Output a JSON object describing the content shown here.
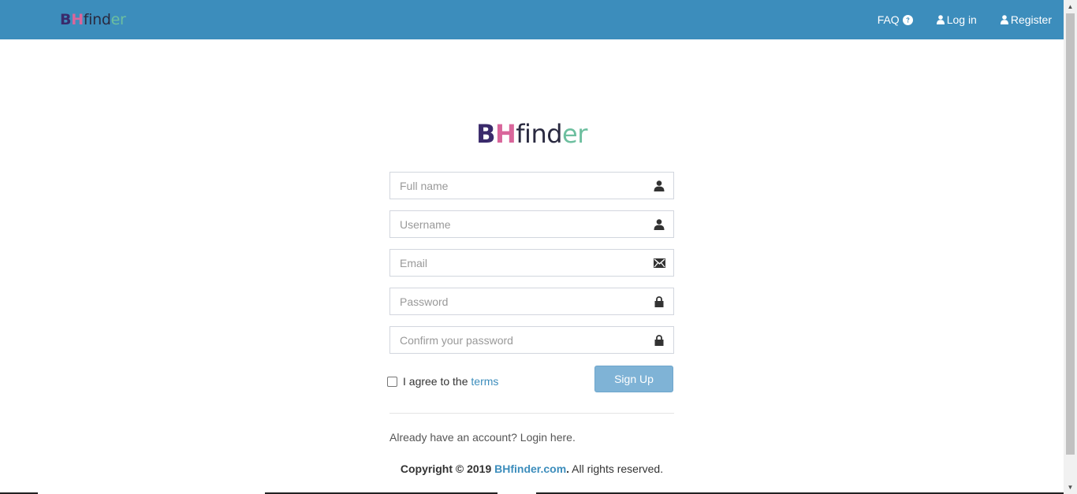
{
  "navbar": {
    "brand": {
      "b": "B",
      "h": "H",
      "find": "find",
      "er": "er"
    },
    "links": {
      "faq": "FAQ",
      "login": "Log in",
      "register": "Register"
    }
  },
  "logo": {
    "b": "B",
    "h": "H",
    "find": "find",
    "er": "er"
  },
  "form": {
    "fullname_placeholder": "Full name",
    "username_placeholder": "Username",
    "email_placeholder": "Email",
    "password_placeholder": "Password",
    "confirm_placeholder": "Confirm your password",
    "agree_prefix": "I agree to the ",
    "agree_link": "terms",
    "agree_checked": false,
    "signup_label": "Sign Up",
    "login_link": "Already have an account? Login here."
  },
  "footer": {
    "copyright_prefix": "Copyright © 2019 ",
    "site": "BHfinder.com",
    "dot": ".",
    "rights": " All rights reserved."
  },
  "colors": {
    "navbar": "#3c8dbc",
    "link": "#3c8dbc",
    "brand_purple": "#3a2a6b",
    "brand_pink": "#d9669b",
    "brand_green": "#6dbf9f",
    "button": "#7fb3d6"
  },
  "icons": {
    "faq": "question-circle-icon",
    "login": "user-icon",
    "register": "user-icon",
    "fullname": "user-icon",
    "username": "user-icon",
    "email": "envelope-icon",
    "password": "lock-icon",
    "confirm": "lock-icon"
  }
}
